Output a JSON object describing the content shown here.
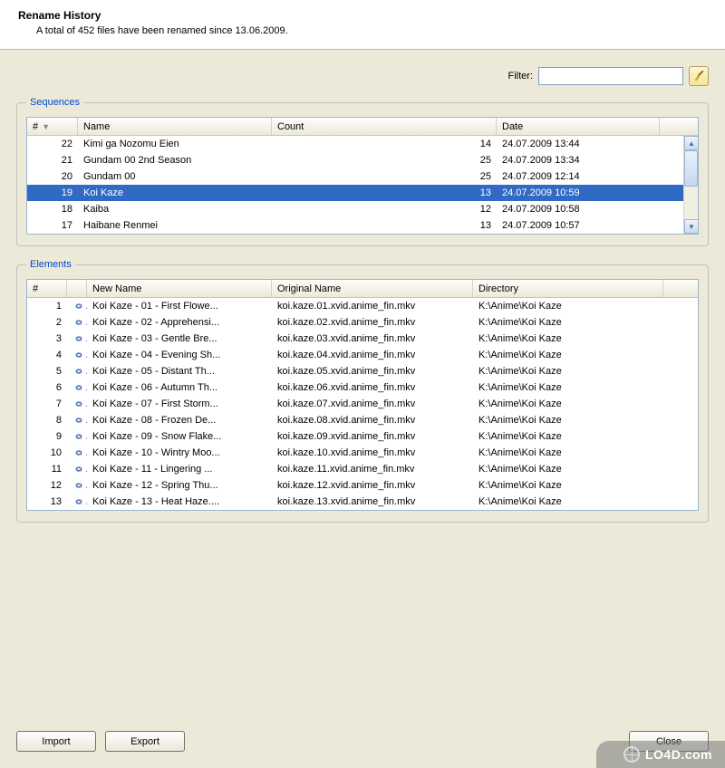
{
  "header": {
    "title": "Rename History",
    "subtitle": "A total of 452 files have been renamed since 13.06.2009."
  },
  "filter": {
    "label": "Filter:",
    "value": ""
  },
  "sequences": {
    "legend": "Sequences",
    "columns": {
      "num": "#",
      "name": "Name",
      "count": "Count",
      "date": "Date"
    },
    "rows": [
      {
        "num": "22",
        "name": "Kimi ga Nozomu Eien",
        "count": "14",
        "date": "24.07.2009 13:44",
        "selected": false
      },
      {
        "num": "21",
        "name": "Gundam 00 2nd Season",
        "count": "25",
        "date": "24.07.2009 13:34",
        "selected": false
      },
      {
        "num": "20",
        "name": "Gundam 00",
        "count": "25",
        "date": "24.07.2009 12:14",
        "selected": false
      },
      {
        "num": "19",
        "name": "Koi Kaze",
        "count": "13",
        "date": "24.07.2009 10:59",
        "selected": true
      },
      {
        "num": "18",
        "name": "Kaiba",
        "count": "12",
        "date": "24.07.2009 10:58",
        "selected": false
      },
      {
        "num": "17",
        "name": "Haibane Renmei",
        "count": "13",
        "date": "24.07.2009 10:57",
        "selected": false
      }
    ]
  },
  "elements": {
    "legend": "Elements",
    "columns": {
      "num": "#",
      "newname": "New Name",
      "origname": "Original Name",
      "dir": "Directory"
    },
    "rows": [
      {
        "num": "1",
        "newname": "Koi Kaze - 01 - First Flowe...",
        "origname": "koi.kaze.01.xvid.anime_fin.mkv",
        "dir": "K:\\Anime\\Koi Kaze"
      },
      {
        "num": "2",
        "newname": "Koi Kaze - 02 - Apprehensi...",
        "origname": "koi.kaze.02.xvid.anime_fin.mkv",
        "dir": "K:\\Anime\\Koi Kaze"
      },
      {
        "num": "3",
        "newname": "Koi Kaze - 03 - Gentle Bre...",
        "origname": "koi.kaze.03.xvid.anime_fin.mkv",
        "dir": "K:\\Anime\\Koi Kaze"
      },
      {
        "num": "4",
        "newname": "Koi Kaze - 04 - Evening Sh...",
        "origname": "koi.kaze.04.xvid.anime_fin.mkv",
        "dir": "K:\\Anime\\Koi Kaze"
      },
      {
        "num": "5",
        "newname": "Koi Kaze - 05 - Distant Th...",
        "origname": "koi.kaze.05.xvid.anime_fin.mkv",
        "dir": "K:\\Anime\\Koi Kaze"
      },
      {
        "num": "6",
        "newname": "Koi Kaze - 06 - Autumn Th...",
        "origname": "koi.kaze.06.xvid.anime_fin.mkv",
        "dir": "K:\\Anime\\Koi Kaze"
      },
      {
        "num": "7",
        "newname": "Koi Kaze - 07 - First Storm...",
        "origname": "koi.kaze.07.xvid.anime_fin.mkv",
        "dir": "K:\\Anime\\Koi Kaze"
      },
      {
        "num": "8",
        "newname": "Koi Kaze - 08 - Frozen De...",
        "origname": "koi.kaze.08.xvid.anime_fin.mkv",
        "dir": "K:\\Anime\\Koi Kaze"
      },
      {
        "num": "9",
        "newname": "Koi Kaze - 09 - Snow Flake...",
        "origname": "koi.kaze.09.xvid.anime_fin.mkv",
        "dir": "K:\\Anime\\Koi Kaze"
      },
      {
        "num": "10",
        "newname": "Koi Kaze - 10 - Wintry Moo...",
        "origname": "koi.kaze.10.xvid.anime_fin.mkv",
        "dir": "K:\\Anime\\Koi Kaze"
      },
      {
        "num": "11",
        "newname": "Koi Kaze - 11 - Lingering ...",
        "origname": "koi.kaze.11.xvid.anime_fin.mkv",
        "dir": "K:\\Anime\\Koi Kaze"
      },
      {
        "num": "12",
        "newname": "Koi Kaze - 12 - Spring Thu...",
        "origname": "koi.kaze.12.xvid.anime_fin.mkv",
        "dir": "K:\\Anime\\Koi Kaze"
      },
      {
        "num": "13",
        "newname": "Koi Kaze - 13 - Heat Haze....",
        "origname": "koi.kaze.13.xvid.anime_fin.mkv",
        "dir": "K:\\Anime\\Koi Kaze"
      }
    ]
  },
  "buttons": {
    "import": "Import",
    "export": "Export",
    "close": "Close"
  },
  "watermark": "LO4D.com"
}
